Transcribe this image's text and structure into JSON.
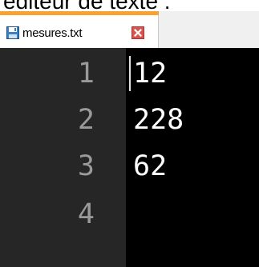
{
  "caption": "éditeur de texte :",
  "tab": {
    "filename": "mesures.txt",
    "accent_color": "#f7a233",
    "icon": "save-file-icon",
    "close_icon": "close-icon"
  },
  "editor": {
    "lines": [
      {
        "number": "1",
        "text": "12"
      },
      {
        "number": "2",
        "text": "228"
      },
      {
        "number": "3",
        "text": "62"
      },
      {
        "number": "4",
        "text": ""
      }
    ]
  }
}
